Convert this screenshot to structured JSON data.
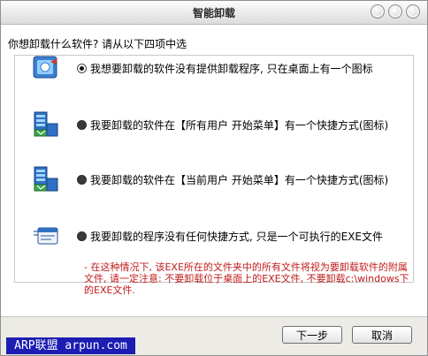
{
  "window": {
    "title": "智能卸载"
  },
  "prompt": "你想卸载什么软件? 请从以下四项中选",
  "options": [
    {
      "label": "我想要卸载的软件没有提供卸载程序, 只在桌面上有一个图标",
      "selected": true
    },
    {
      "label": "我要卸载的软件在【所有用户 开始菜单】有一个快捷方式(图标)",
      "selected": false
    },
    {
      "label": "我要卸载的软件在【当前用户 开始菜单】有一个快捷方式(图标)",
      "selected": false
    },
    {
      "label": "我要卸载的程序没有任何快捷方式, 只是一个可执行的EXE文件",
      "selected": false
    }
  ],
  "note": "- 在这种情况下, 该EXE所在的文件夹中的所有文件将视为要卸载软件的附属文件, 请一定注意: 不要卸载位于桌面上的EXE文件, 不要卸载c:\\windows下的EXE文件.",
  "buttons": {
    "next": "下一步",
    "cancel": "取消"
  },
  "watermark": "ARP联盟 arpun.com",
  "icons": {
    "option1": "desktop-shortcut-icon",
    "option2": "all-users-start-menu-icon",
    "option3": "current-user-start-menu-icon",
    "option4": "exe-file-icon"
  },
  "colors": {
    "note": "#c01a1a",
    "watermark_bg": "#1d1db4"
  }
}
